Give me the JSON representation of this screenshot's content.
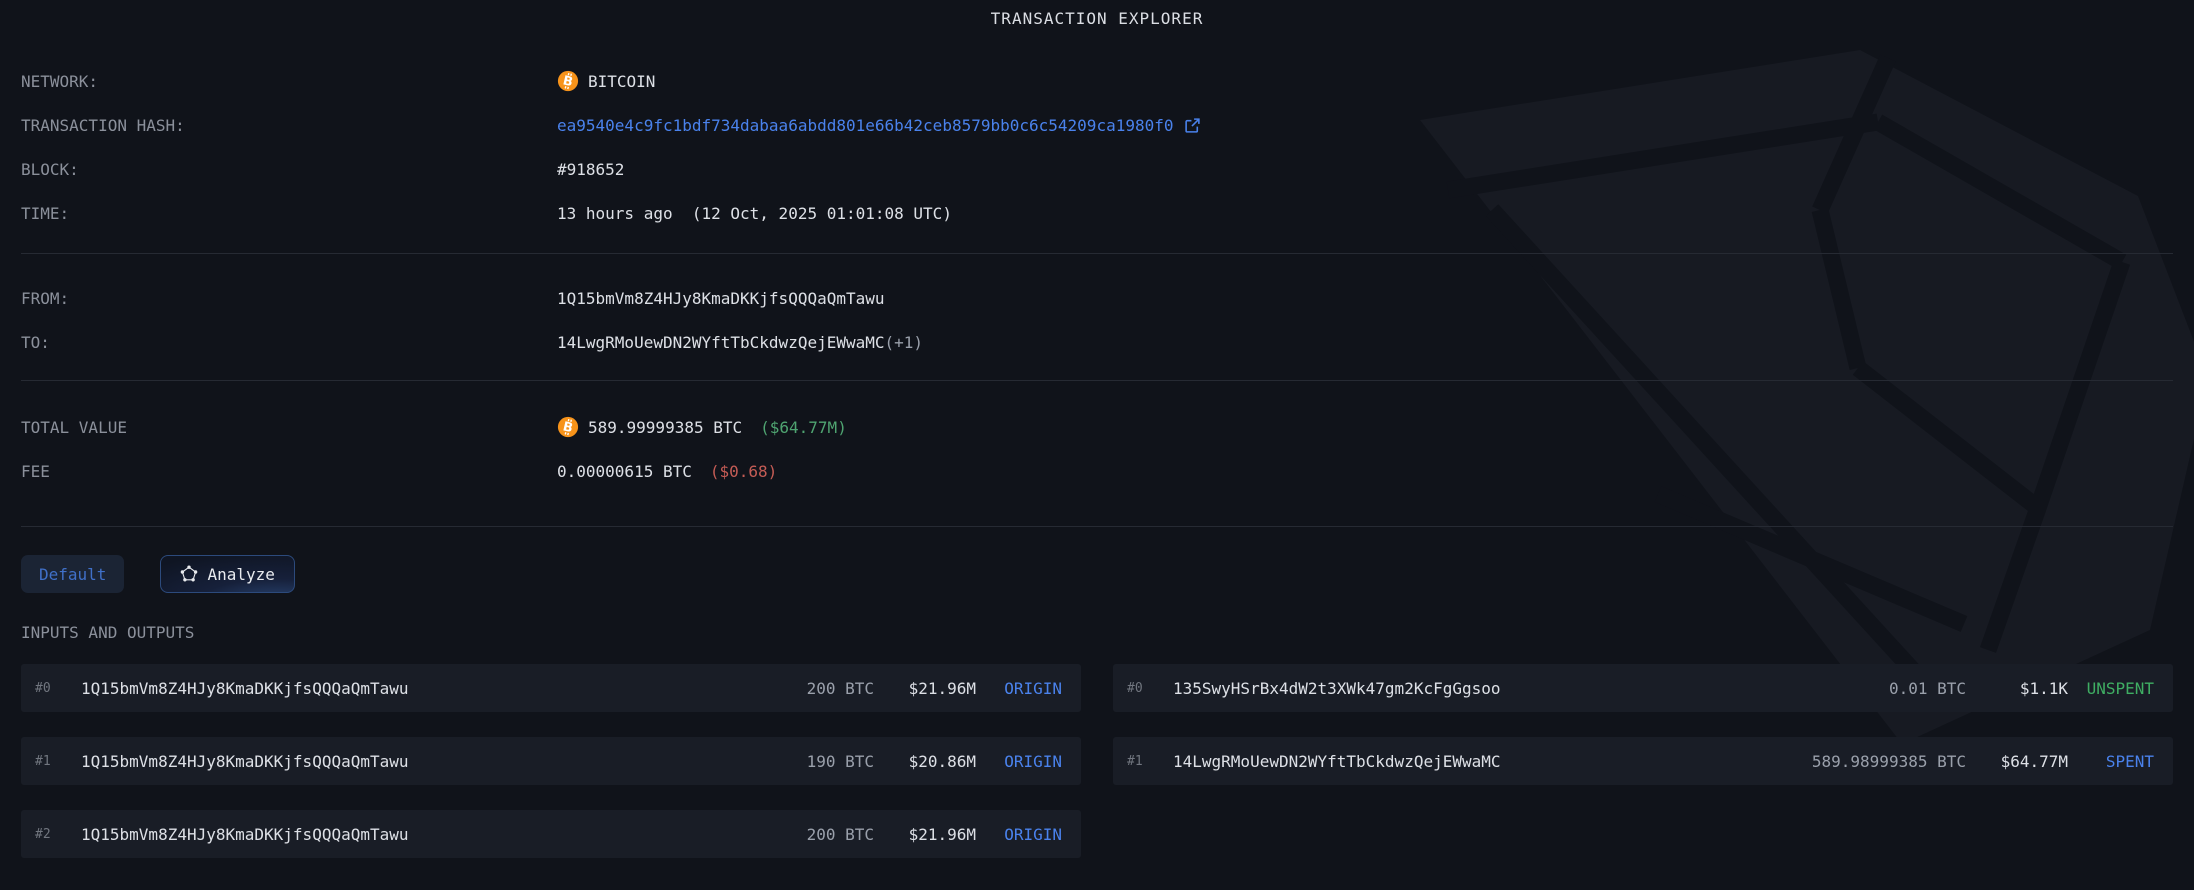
{
  "colors": {
    "bg": "#10131a",
    "panel": "#191d26",
    "watermark": "#171a22",
    "divider": "#262a33",
    "label": "#8b909b",
    "text": "#dde0e6",
    "muted": "#9aa0ab",
    "dim": "#71767f",
    "link": "#4a82ec",
    "green-usd": "#4fa471",
    "green-status": "#3fae63",
    "red": "#c45c55",
    "orange": "#f7931a",
    "btn-default-bg": "#1b2434",
    "btn-default-text": "#4070c8",
    "btn-analyze-border": "#2c4a7c"
  },
  "header": {
    "title": "TRANSACTION EXPLORER"
  },
  "details": {
    "network_label": "NETWORK:",
    "network_value": "BITCOIN",
    "hash_label": "TRANSACTION HASH:",
    "hash_value": "ea9540e4c9fc1bdf734dabaa6abdd801e66b42ceb8579bb0c6c54209ca1980f0",
    "block_label": "BLOCK:",
    "block_value": "#918652",
    "time_label": "TIME:",
    "time_value": "13 hours ago  (12 Oct, 2025 01:01:08 UTC)",
    "from_label": "FROM:",
    "from_value": "1Q15bmVm8Z4HJy8KmaDKKjfsQQQaQmTawu",
    "to_label": "TO:",
    "to_value": "14LwgRMoUewDN2WYftTbCkdwzQejEWwaMC",
    "to_suffix": "(+1)",
    "total_label": "TOTAL VALUE",
    "total_btc": "589.99999385 BTC",
    "total_usd": "($64.77M)",
    "fee_label": "FEE",
    "fee_btc": "0.00000615 BTC",
    "fee_usd": "($0.68)"
  },
  "toolbar": {
    "default_label": "Default",
    "analyze_label": "Analyze"
  },
  "io": {
    "heading": "INPUTS AND OUTPUTS",
    "inputs": [
      {
        "index": "#0",
        "address": "1Q15bmVm8Z4HJy8KmaDKKjfsQQQaQmTawu",
        "btc": "200 BTC",
        "usd": "$21.96M",
        "status": "ORIGIN",
        "status_type": "st-origin"
      },
      {
        "index": "#1",
        "address": "1Q15bmVm8Z4HJy8KmaDKKjfsQQQaQmTawu",
        "btc": "190 BTC",
        "usd": "$20.86M",
        "status": "ORIGIN",
        "status_type": "st-origin"
      },
      {
        "index": "#2",
        "address": "1Q15bmVm8Z4HJy8KmaDKKjfsQQQaQmTawu",
        "btc": "200 BTC",
        "usd": "$21.96M",
        "status": "ORIGIN",
        "status_type": "st-origin"
      }
    ],
    "outputs": [
      {
        "index": "#0",
        "address": "135SwyHSrBx4dW2t3XWk47gm2KcFgGgsoo",
        "btc": "0.01 BTC",
        "usd": "$1.1K",
        "status": "UNSPENT",
        "status_type": "st-unspent"
      },
      {
        "index": "#1",
        "address": "14LwgRMoUewDN2WYftTbCkdwzQejEWwaMC",
        "btc": "589.98999385 BTC",
        "usd": "$64.77M",
        "status": "SPENT",
        "status_type": "st-spent"
      }
    ]
  }
}
